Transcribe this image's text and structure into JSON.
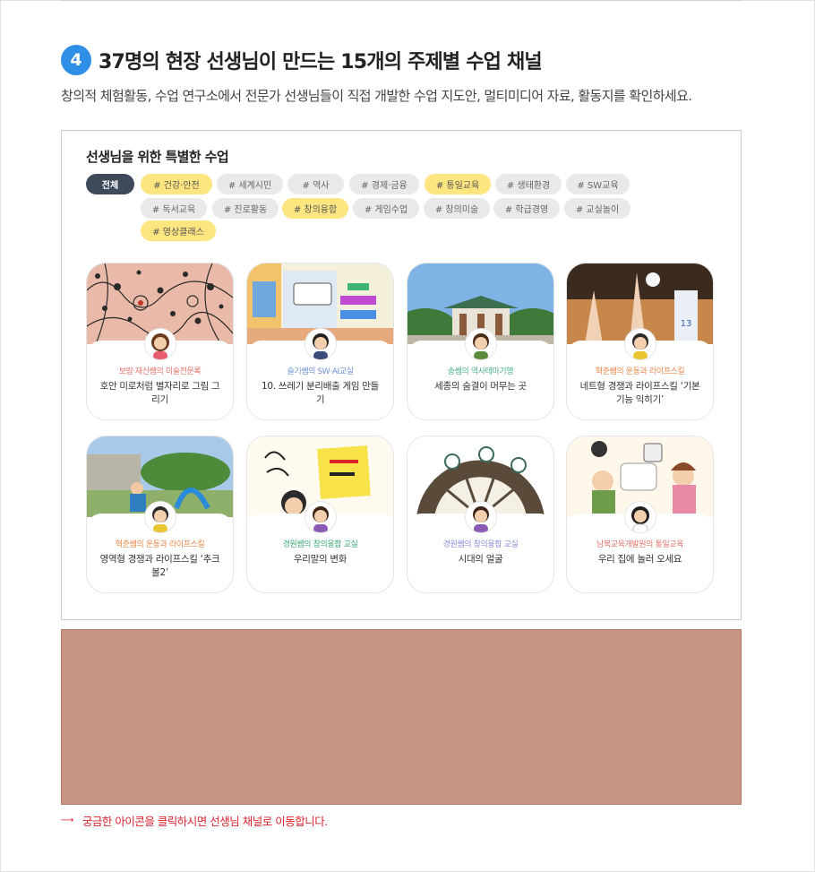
{
  "section": {
    "step_number": "4",
    "heading": "37명의 현장 선생님이 만드는 15개의 주제별 수업 채널",
    "subtitle": "창의적 체험활동, 수업 연구소에서 전문가 선생님들이 직접 개발한 수업 지도안, 멀티미디어 자료, 활동지를 확인하세요."
  },
  "channel_box": {
    "title": "선생님을 위한 특별한 수업",
    "tags": [
      {
        "label": "전체",
        "style": "active"
      },
      {
        "label": "# 건강·안전",
        "style": "highlight"
      },
      {
        "label": "# 세계시민",
        "style": "normal"
      },
      {
        "label": "# 역사",
        "style": "normal"
      },
      {
        "label": "# 경제·금융",
        "style": "normal"
      },
      {
        "label": "# 통일교육",
        "style": "highlight"
      },
      {
        "label": "# 생태환경",
        "style": "normal"
      },
      {
        "label": "# SW교육",
        "style": "normal"
      },
      {
        "label": "# 독서교육",
        "style": "normal"
      },
      {
        "label": "# 진로활동",
        "style": "normal"
      },
      {
        "label": "# 창의융합",
        "style": "highlight"
      },
      {
        "label": "# 게임수업",
        "style": "normal"
      },
      {
        "label": "# 창의미술",
        "style": "normal"
      },
      {
        "label": "# 학급경영",
        "style": "normal"
      },
      {
        "label": "# 교실놀이",
        "style": "normal"
      },
      {
        "label": "# 영상클래스",
        "style": "highlight"
      }
    ],
    "cards": [
      {
        "channel": "보람·재신쌤의 미술전문록",
        "title": "호안 미로처럼 별자리로 그림 그리기",
        "channel_color": "#e0736a"
      },
      {
        "channel": "슬기쌤의 SW·AI교실",
        "title": "10. 쓰레기 분리배출 게임 만들기",
        "channel_color": "#6d8fd6"
      },
      {
        "channel": "송쌤의 역사테마기행",
        "title": "세종의 숨결이 머무는 곳",
        "channel_color": "#4cb08a"
      },
      {
        "channel": "혁준쌤의 운동과 라이프스킬",
        "title": "네트형 경쟁과 라이프스킬 ‘기본 기능 익히기’",
        "channel_color": "#e7884a"
      },
      {
        "channel": "혁준쌤의 운동과 라이프스킬",
        "title": "영역형 경쟁과 라이프스킬 ‘추크볼2’",
        "channel_color": "#e7884a"
      },
      {
        "channel": "경원쌤의 창의융합 교실",
        "title": "우리말의 변화",
        "channel_color": "#3eab7a"
      },
      {
        "channel": "경원쌤의 창의융합 교실",
        "title": "시대의 얼굴",
        "channel_color": "#8a8fd6"
      },
      {
        "channel": "남북교육개발원의 통일교육",
        "title": "우리 집에 놀러 오세요",
        "channel_color": "#e0736a"
      }
    ]
  },
  "notice": {
    "arrow": "⟶",
    "text": "궁금한 아이콘을 클릭하시면 선생님 채널로 이동합니다."
  },
  "colors": {
    "accent_blue": "#2f8ee6",
    "tag_highlight": "#fde57f",
    "tag_active": "#3e4a5a",
    "banner": "#c89484",
    "notice_red": "#d9232d"
  }
}
